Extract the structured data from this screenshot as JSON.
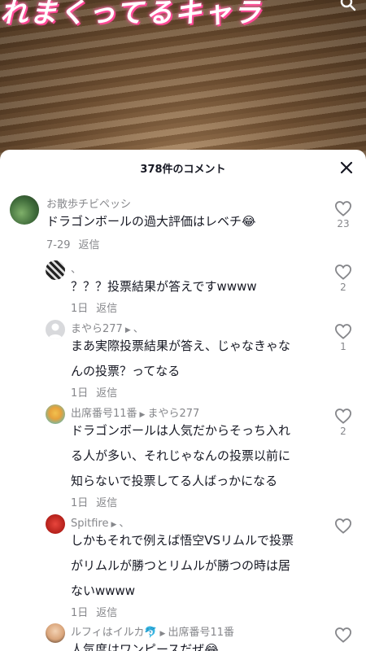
{
  "video": {
    "caption": "れまくってるキャラ"
  },
  "sheet": {
    "title": "378件のコメント"
  },
  "comments": [
    {
      "user": "お散歩チビペッシ",
      "lines": [
        "ドラゴンボールの過大評価はレベチ😂"
      ],
      "date": "7-29",
      "reply": "返信",
      "likes": "23"
    },
    {
      "user": "、",
      "lines": [
        "？？？投票結果が答えですwwww"
      ],
      "date": "1日",
      "reply": "返信",
      "likes": "2"
    },
    {
      "user": "まやら277",
      "reply_to": "、",
      "lines": [
        "まあ実際投票結果が答え、じゃなきゃな",
        "んの投票？ってなる"
      ],
      "date": "1日",
      "reply": "返信",
      "likes": "1"
    },
    {
      "user": "出席番号11番",
      "reply_to": "まやら277",
      "lines": [
        "ドラゴンボールは人気だからそっち入れ",
        "る人が多い、それじゃなんの投票以前に",
        "知らないで投票してる人ばっかになる"
      ],
      "date": "1日",
      "reply": "返信",
      "likes": "2"
    },
    {
      "user": "Spitfire",
      "reply_to": "、",
      "lines": [
        "しかもそれで例えば悟空VSリムルで投票",
        "がリムルが勝つとリムルが勝つの時は居",
        "ないwwww"
      ],
      "date": "1日",
      "reply": "返信",
      "likes": ""
    },
    {
      "user": "ルフィはイルカ🐬",
      "reply_to": "出席番号11番",
      "lines": [
        "人気度はワンピースだぜ😂"
      ],
      "date": "",
      "reply": "",
      "likes": ""
    }
  ],
  "colors": {
    "text_primary": "#161823",
    "text_secondary": "#86878b",
    "sheet_bg": "#ffffff"
  }
}
